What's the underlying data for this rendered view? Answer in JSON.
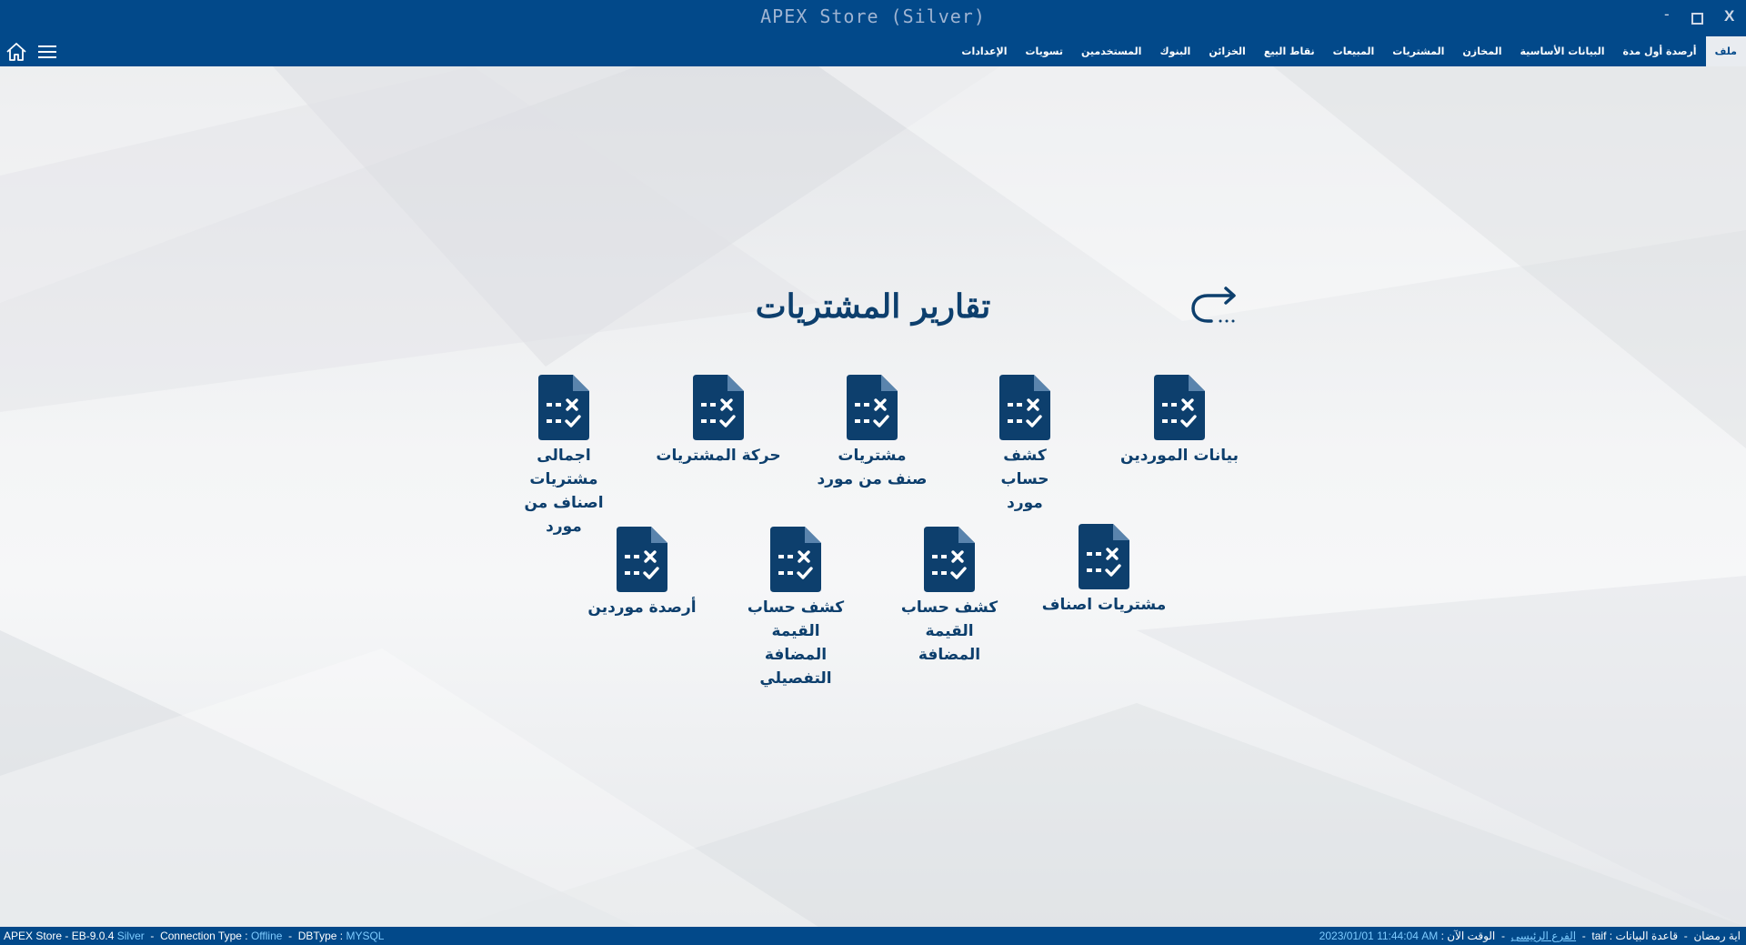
{
  "window": {
    "title": "APEX Store (Silver)",
    "minimize": "-",
    "close": "X"
  },
  "menu": {
    "items": [
      {
        "label": "ملف",
        "active": true
      },
      {
        "label": "أرصدة أول مدة"
      },
      {
        "label": "البيانات الأساسية"
      },
      {
        "label": "المخازن"
      },
      {
        "label": "المشتريات"
      },
      {
        "label": "المبيعات"
      },
      {
        "label": "نقاط البيع"
      },
      {
        "label": "الخزائن"
      },
      {
        "label": "البنوك"
      },
      {
        "label": "المستخدمين"
      },
      {
        "label": "تسويات"
      },
      {
        "label": "الإعدادات"
      }
    ],
    "icons": [
      "home-icon",
      "hamburger-menu-icon"
    ]
  },
  "page": {
    "title": "تقارير المشتريات",
    "back_icon": "back-arrow-icon",
    "tile_icon": "report-document-icon",
    "tiles": [
      {
        "label": "بيانات الموردين"
      },
      {
        "label": "كشف حساب مورد"
      },
      {
        "label": "مشتريات صنف من مورد"
      },
      {
        "label": "حركة المشتريات"
      },
      {
        "label": "اجمالى مشتريات اصناف من مورد"
      },
      {
        "label": "مشتريات اصناف"
      },
      {
        "label": "كشف حساب القيمة المضافة"
      },
      {
        "label": "كشف حساب القيمة المضافة التفصيلي"
      },
      {
        "label": "أرصدة موردين"
      }
    ]
  },
  "status": {
    "left": {
      "product": "APEX Store - EB-9.0.4",
      "edition": "Silver",
      "sep": "-",
      "connection_label": "Connection Type :",
      "connection_value": "Offline",
      "dbtype_label": "DBType :",
      "dbtype_value": "MYSQL"
    },
    "right": {
      "user": "اية رمضان",
      "database_label": "قاعدة البيانات :",
      "database_value": "taif",
      "branch": "الفرع الرئيسى",
      "time_label": "الوقت الآن :",
      "time_value": "2023/01/01 11:44:04 AM",
      "sep": "-"
    }
  },
  "colors": {
    "primary": "#02498a",
    "icon": "#0d3f6d",
    "accent": "#7ecbff",
    "background": "#f2f3f5"
  }
}
